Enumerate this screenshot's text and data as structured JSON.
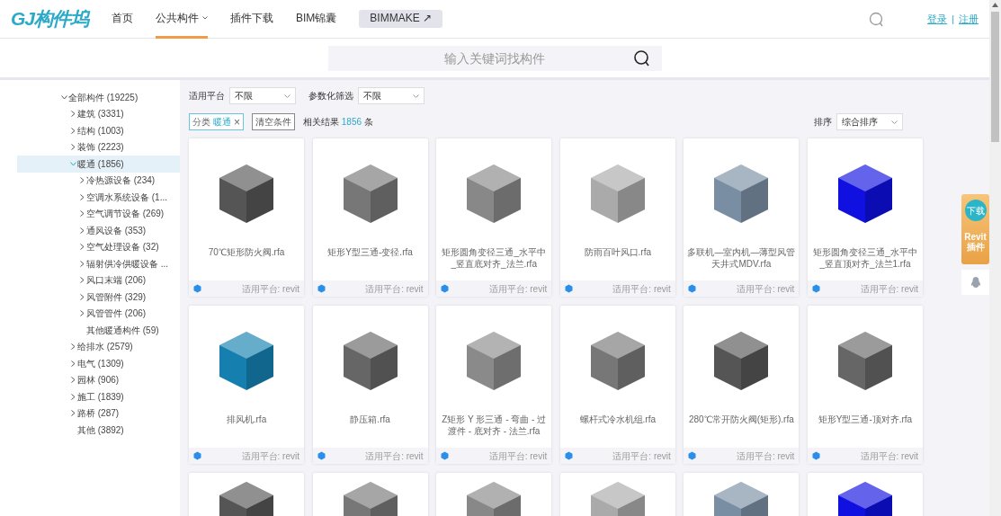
{
  "header": {
    "logo": "GJ构件坞",
    "nav": [
      {
        "label": "首页",
        "selected": false,
        "kind": "link"
      },
      {
        "label": "公共构件",
        "selected": true,
        "kind": "dropdown"
      },
      {
        "label": "插件下载",
        "selected": false,
        "kind": "link"
      },
      {
        "label": "BIM锦囊",
        "selected": false,
        "kind": "link"
      },
      {
        "label": "BIMMAKE ↗",
        "selected": false,
        "kind": "pill"
      }
    ],
    "login": "登录",
    "separator": "|",
    "register": "注册"
  },
  "search": {
    "placeholder": "输入关键词找构件"
  },
  "sidebar": {
    "items": [
      {
        "label": "全部构件 (19225)",
        "expanded": true,
        "selected": false,
        "children": [
          {
            "label": "建筑 (3331)",
            "expanded": false,
            "selected": false
          },
          {
            "label": "结构 (1003)",
            "expanded": false,
            "selected": false
          },
          {
            "label": "装饰 (2223)",
            "expanded": false,
            "selected": false
          },
          {
            "label": "暖通 (1856)",
            "expanded": true,
            "selected": true,
            "children": [
              {
                "label": "冷热源设备 (234)",
                "expanded": false,
                "selected": false
              },
              {
                "label": "空调水系统设备 (1...",
                "expanded": false,
                "selected": false
              },
              {
                "label": "空气调节设备 (269)",
                "expanded": false,
                "selected": false
              },
              {
                "label": "通风设备 (353)",
                "expanded": false,
                "selected": false
              },
              {
                "label": "空气处理设备 (32)",
                "expanded": false,
                "selected": false
              },
              {
                "label": "辐射供冷供暖设备 ...",
                "expanded": false,
                "selected": false
              },
              {
                "label": "风口末端 (206)",
                "expanded": false,
                "selected": false
              },
              {
                "label": "风管附件 (329)",
                "expanded": false,
                "selected": false
              },
              {
                "label": "风管管件 (206)",
                "expanded": false,
                "selected": false
              },
              {
                "label": "其他暖通构件 (59)",
                "selected": false
              }
            ]
          },
          {
            "label": "给排水 (2579)",
            "expanded": false,
            "selected": false
          },
          {
            "label": "电气 (1309)",
            "expanded": false,
            "selected": false
          },
          {
            "label": "园林 (906)",
            "expanded": false,
            "selected": false
          },
          {
            "label": "施工 (1839)",
            "expanded": false,
            "selected": false
          },
          {
            "label": "路桥 (287)",
            "expanded": false,
            "selected": false
          },
          {
            "label": "其他 (3892)",
            "selected": false
          }
        ]
      }
    ]
  },
  "filters": [
    {
      "label": "适用平台",
      "value": "不限"
    },
    {
      "label": "参数化筛选",
      "value": "不限"
    }
  ],
  "active_tag": {
    "key": "分类",
    "value": "暖通",
    "close": "×"
  },
  "clear_button": "清空条件",
  "result": {
    "prefix": "相关结果",
    "count": "1856",
    "suffix": "条"
  },
  "sort": {
    "label": "排序",
    "value": "综合排序"
  },
  "cards": [
    {
      "kind": "full",
      "title": "70℃矩形防火阀.rfa",
      "platform": "适用平台: revit"
    },
    {
      "kind": "full",
      "title": "矩形Y型三通-变径.rfa",
      "platform": "适用平台: revit"
    },
    {
      "kind": "full",
      "title": "矩形圆角变径三通_水平中_竖直底对齐_法兰.rfa",
      "platform": "适用平台: revit"
    },
    {
      "kind": "full",
      "title": "防雨百叶风口.rfa",
      "platform": "适用平台: revit"
    },
    {
      "kind": "full",
      "title": "多联机—室内机—薄型风管天井式MDV.rfa",
      "platform": "适用平台: revit"
    },
    {
      "kind": "full",
      "title": "矩形圆角变径三通_水平中_竖直顶对齐_法兰1.rfa",
      "platform": "适用平台: revit"
    },
    {
      "kind": "full",
      "title": "排风机.rfa",
      "platform": "适用平台: revit"
    },
    {
      "kind": "full",
      "title": "静压箱.rfa",
      "platform": "适用平台: revit"
    },
    {
      "kind": "full",
      "title": "Z矩形 Y 形三通 - 弯曲 - 过渡件 - 底对齐 - 法兰.rfa",
      "platform": "适用平台: revit"
    },
    {
      "kind": "full",
      "title": "螺杆式冷水机组.rfa",
      "platform": "适用平台: revit"
    },
    {
      "kind": "full",
      "title": "280℃常开防火阀(矩形).rfa",
      "platform": "适用平台: revit"
    },
    {
      "kind": "full",
      "title": "矩形Y型三通-顶对齐.rfa",
      "platform": "适用平台: revit"
    },
    {
      "kind": "partial"
    },
    {
      "kind": "partial"
    },
    {
      "kind": "partial"
    },
    {
      "kind": "partial"
    },
    {
      "kind": "partial"
    },
    {
      "kind": "partial"
    }
  ],
  "side_widget": {
    "badge": "下载",
    "title": "Revit",
    "subtitle": "插件"
  }
}
